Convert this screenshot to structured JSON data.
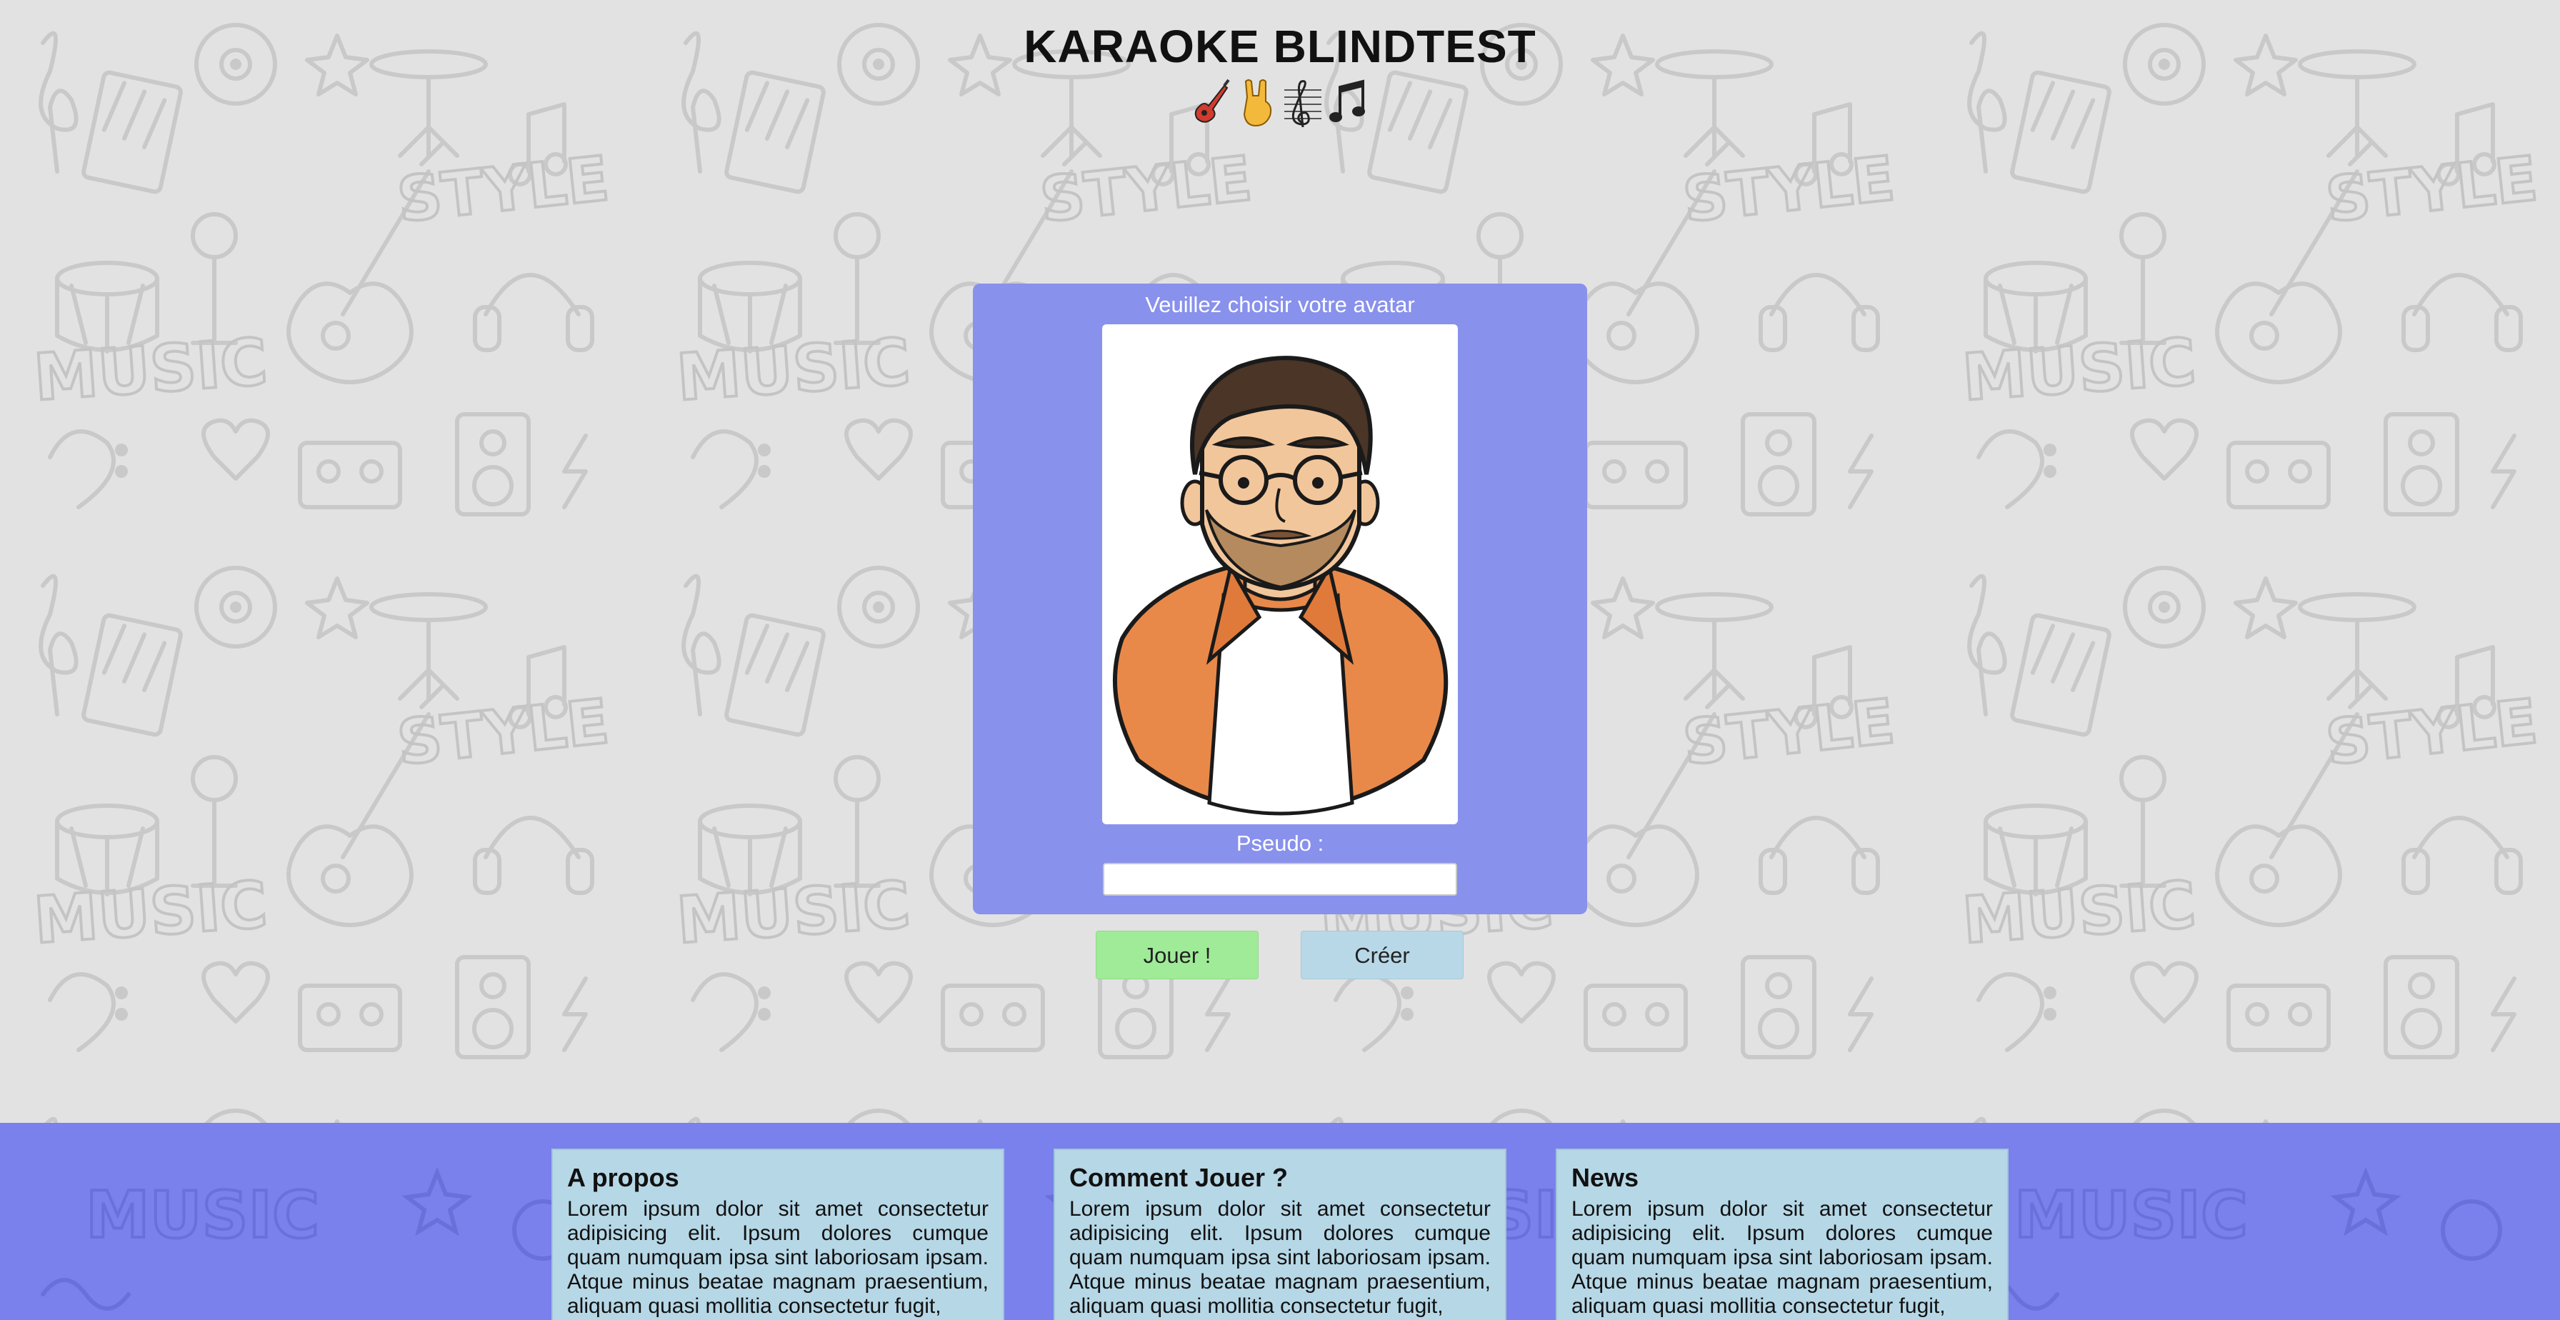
{
  "header": {
    "title": "KARAOKE BLINDTEST"
  },
  "decor": {
    "emojis": [
      "guitar-emoji",
      "rock-hand-emoji",
      "treble-clef-staff-emoji",
      "music-notes-emoji"
    ],
    "pattern_words": [
      "STYLE",
      "MUSIC"
    ]
  },
  "avatar_card": {
    "prompt": "Veuillez choisir votre avatar",
    "pseudo_label": "Pseudo :",
    "pseudo_value": "",
    "colors": {
      "card_bg": "#8891ec",
      "jacket": "#e8894a"
    }
  },
  "actions": {
    "play_label": "Jouer !",
    "create_label": "Créer",
    "play_color": "#a0eb98",
    "create_color": "#b8d8e8"
  },
  "footer": {
    "sections": [
      {
        "title": "A propos",
        "text": "Lorem ipsum dolor sit amet consectetur adipisicing elit. Ipsum dolores cumque quam numquam ipsa sint laboriosam ipsam. Atque minus beatae magnam praesentium, aliquam quasi mollitia consectetur fugit,"
      },
      {
        "title": "Comment Jouer ?",
        "text": "Lorem ipsum dolor sit amet consectetur adipisicing elit. Ipsum dolores cumque quam numquam ipsa sint laboriosam ipsam. Atque minus beatae magnam praesentium, aliquam quasi mollitia consectetur fugit,"
      },
      {
        "title": "News",
        "text": "Lorem ipsum dolor sit amet consectetur adipisicing elit. Ipsum dolores cumque quam numquam ipsa sint laboriosam ipsam. Atque minus beatae magnam praesentium, aliquam quasi mollitia consectetur fugit,"
      }
    ]
  }
}
